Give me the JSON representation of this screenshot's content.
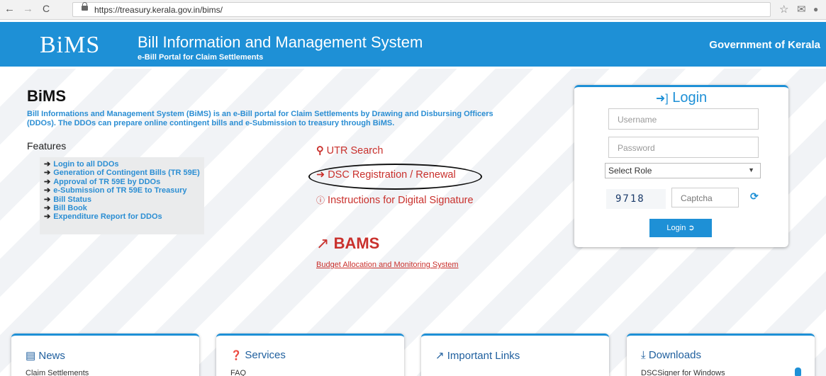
{
  "browser": {
    "url": "https://treasury.kerala.gov.in/bims/",
    "back_icon": "←",
    "forward_icon": "→",
    "reload_icon": "C",
    "star_icon": "☆",
    "mail_icon": "✉",
    "profile_icon": "●"
  },
  "header": {
    "logo": "BiMS",
    "title": "Bill Information and Management System",
    "subtitle": "e-Bill Portal for Claim Settlements",
    "government": "Government of Kerala"
  },
  "main": {
    "brand": "BiMS",
    "description": "Bill Informations and Management System (BiMS) is an e-Bill portal for Claim Settlements by Drawing and Disbursing Officers (DDOs). The DDOs can prepare online contingent bills and e-Submission to treasury through BiMS.",
    "features_title": "Features",
    "features": [
      "Login to all DDOs",
      "Generation of Contingent Bills (TR 59E)",
      "Approval of TR 59E by DDOs",
      "e-Submission of TR 59E to Treasury",
      "Bill Status",
      "Bill Book",
      "Expenditure Report for DDOs"
    ],
    "utr_search": "UTR Search",
    "dsc_registration": "DSC Registration / Renewal",
    "instructions": "Instructions for Digital Signature",
    "bams": "BAMS",
    "bams_sub": "Budget Allocation and Monitoring System"
  },
  "login": {
    "title": "Login",
    "username_placeholder": "Username",
    "password_placeholder": "Password",
    "role_selected": "Select Role",
    "captcha_image_text": "9718",
    "captcha_placeholder": "Captcha",
    "button": "Login"
  },
  "panels": [
    {
      "title": "News",
      "item": "Claim Settlements"
    },
    {
      "title": "Services",
      "item": "FAQ"
    },
    {
      "title": "Important Links",
      "item": ""
    },
    {
      "title": "Downloads",
      "item": "DSCSigner for Windows"
    }
  ]
}
